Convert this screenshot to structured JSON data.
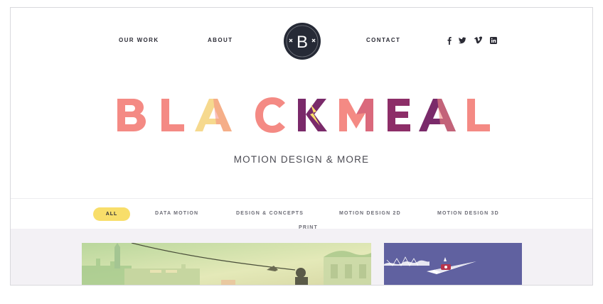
{
  "nav": {
    "our_work": "OUR WORK",
    "about": "ABOUT",
    "contact": "CONTACT",
    "logo_letter": "B",
    "social": [
      "facebook-icon",
      "twitter-icon",
      "vimeo-icon",
      "linkedin-icon"
    ]
  },
  "hero": {
    "brand_name": "BLACKMEAL",
    "tagline": "MOTION DESIGN & MORE"
  },
  "filters": {
    "all": "ALL",
    "items": [
      "DATA MOTION",
      "DESIGN & CONCEPTS",
      "MOTION DESIGN 2D",
      "MOTION DESIGN 3D",
      "PRINT"
    ]
  },
  "colors": {
    "accent_yellow": "#f8de6a",
    "coral": "#f48a84",
    "plum": "#7a2a6a",
    "logo_bg": "#262a36"
  }
}
